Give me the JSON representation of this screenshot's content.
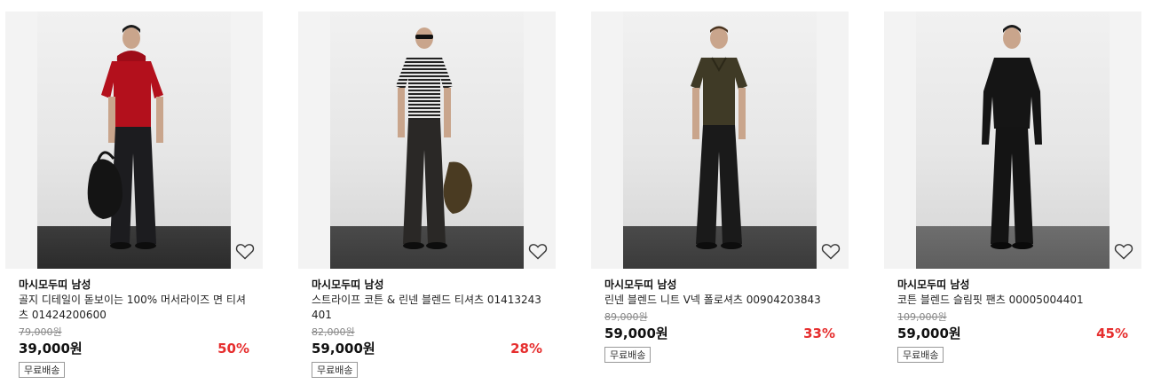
{
  "products": [
    {
      "brand": "마시모두띠 남성",
      "title": "골지 디테일이 돋보이는 100% 머서라이즈 면 티셔츠 01424200600",
      "original_price": "79,000원",
      "price": "39,000원",
      "discount": "50%",
      "badge": "무료배송",
      "shirt_color": "#b3101c",
      "pants_color": "#1c1c1f"
    },
    {
      "brand": "마시모두띠 남성",
      "title": "스트라이프 코튼 & 린넨 블렌드 티셔츠 01413243401",
      "original_price": "82,000원",
      "price": "59,000원",
      "discount": "28%",
      "badge": "무료배송",
      "shirt_color": "#8a8a8a",
      "pants_color": "#2a2826"
    },
    {
      "brand": "마시모두띠 남성",
      "title": "린넨 블렌드 니트 V넥 폴로셔츠 00904203843",
      "original_price": "89,000원",
      "price": "59,000원",
      "discount": "33%",
      "badge": "무료배송",
      "shirt_color": "#3f3a26",
      "pants_color": "#1a1a1a"
    },
    {
      "brand": "마시모두띠 남성",
      "title": "코튼 블렌드 슬림핏 팬츠 00005004401",
      "original_price": "109,000원",
      "price": "59,000원",
      "discount": "45%",
      "badge": "무료배송",
      "shirt_color": "#151515",
      "pants_color": "#141414"
    }
  ],
  "icons": {
    "wishlist": "heart-outline-icon"
  }
}
